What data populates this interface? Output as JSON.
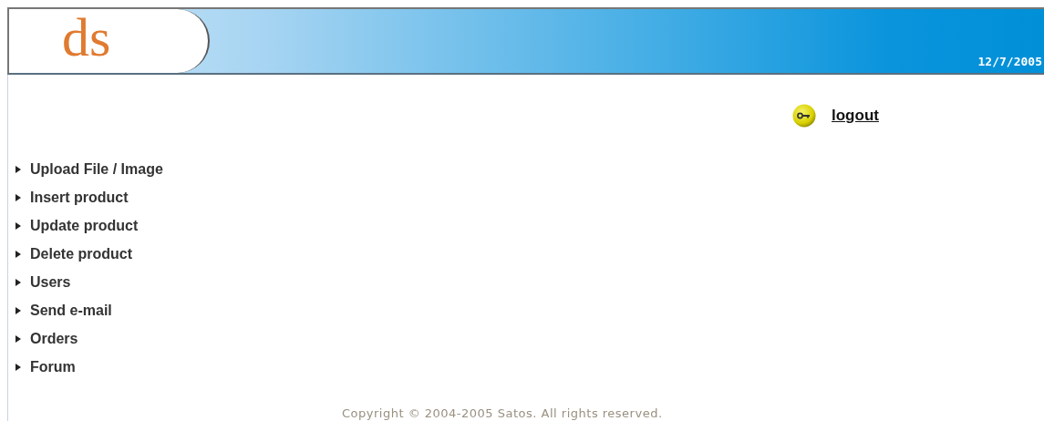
{
  "header": {
    "logo": "ds",
    "date": "12/7/2005"
  },
  "logout": {
    "label": "logout"
  },
  "menu": [
    {
      "label": "Upload File / Image"
    },
    {
      "label": "Insert product"
    },
    {
      "label": "Update product"
    },
    {
      "label": "Delete product"
    },
    {
      "label": "Users"
    },
    {
      "label": "Send e-mail"
    },
    {
      "label": "Orders"
    },
    {
      "label": "Forum"
    }
  ],
  "footer": {
    "text": "Copyright © 2004-2005 Satos. All rights reserved."
  }
}
